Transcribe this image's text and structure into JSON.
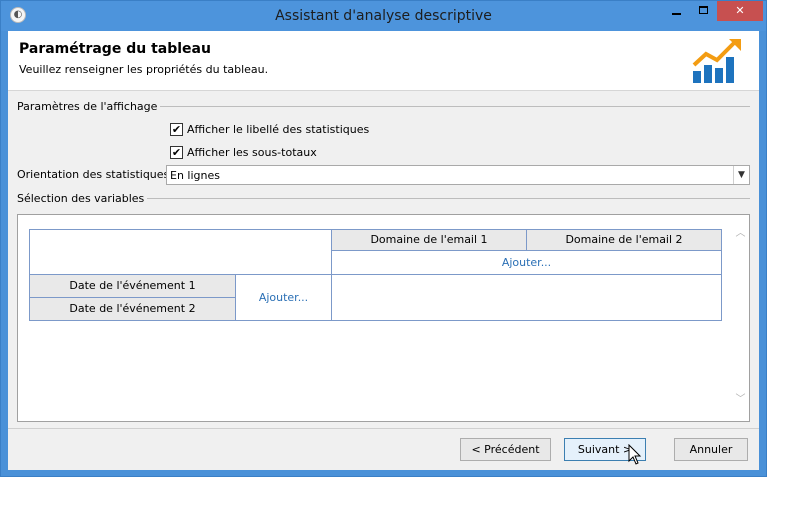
{
  "window": {
    "title": "Assistant d'analyse descriptive",
    "close_glyph": "✕"
  },
  "header": {
    "title": "Paramétrage du tableau",
    "subtitle": "Veuillez renseigner les propriétés du tableau.",
    "logo_icon": "growth-chart-icon"
  },
  "display_settings": {
    "group_label": "Paramètres de l'affichage",
    "show_stat_label": {
      "label": "Afficher le libellé des statistiques",
      "checked": true,
      "mark": "✔"
    },
    "show_subtotals": {
      "label": "Afficher les sous-totaux",
      "checked": true,
      "mark": "✔"
    },
    "orientation": {
      "label": "Orientation des statistiques:",
      "value": "En lignes",
      "arrow": "▼"
    }
  },
  "variables": {
    "group_label": "Sélection des variables",
    "columns": [
      "Domaine de l'email 1",
      "Domaine de l'email 2"
    ],
    "column_add": "Ajouter...",
    "rows": [
      "Date de l'événement 1",
      "Date de l'événement 2"
    ],
    "row_add": "Ajouter...",
    "scroll_up": "︿",
    "scroll_down": "﹀"
  },
  "buttons": {
    "previous": "< Précédent",
    "next": "Suivant >",
    "cancel": "Annuler"
  },
  "colors": {
    "titlebar": "#4d94dc",
    "close": "#c75050",
    "link": "#2a6fb5",
    "grid_border": "#7c99c9"
  }
}
